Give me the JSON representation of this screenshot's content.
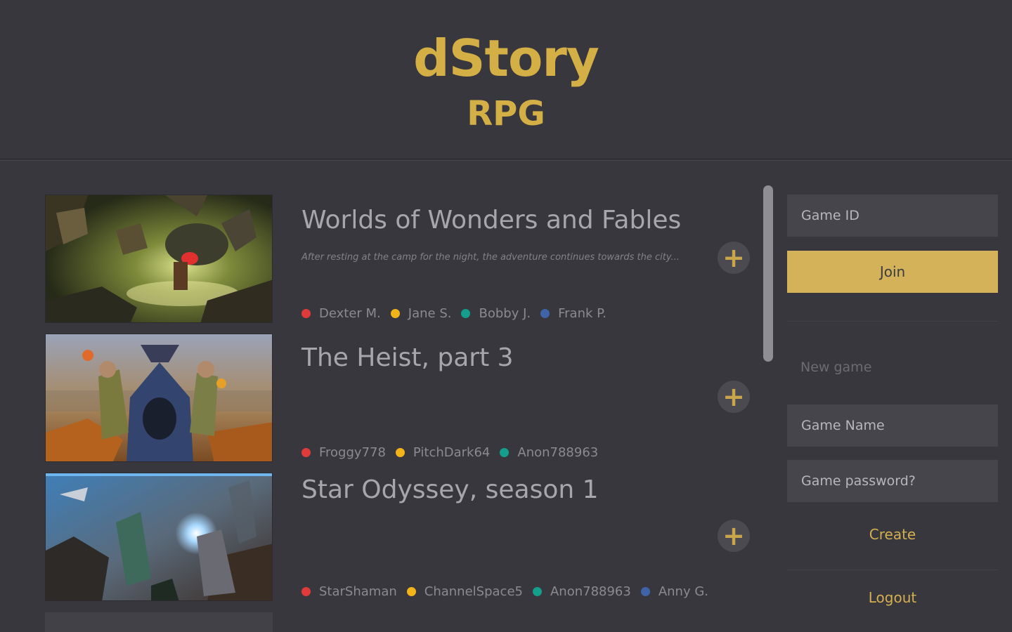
{
  "header": {
    "title": "dStory",
    "subtitle": "RPG"
  },
  "games": [
    {
      "title": "Worlds of Wonders and Fables",
      "description": "After resting at the camp for the night, the adventure continues towards the city...",
      "image": "fantasy-cave-artwork",
      "players": [
        {
          "name": "Dexter M.",
          "color": "#e03a3a"
        },
        {
          "name": "Jane S.",
          "color": "#f2b418"
        },
        {
          "name": "Bobby J.",
          "color": "#149e8c"
        },
        {
          "name": "Frank P.",
          "color": "#3f63a8"
        }
      ]
    },
    {
      "title": "The Heist, part 3",
      "description": "",
      "image": "hooded-figure-artwork",
      "players": [
        {
          "name": "Froggy778",
          "color": "#e03a3a"
        },
        {
          "name": "PitchDark64",
          "color": "#f2b418"
        },
        {
          "name": "Anon788963",
          "color": "#149e8c"
        }
      ]
    },
    {
      "title": "Star Odyssey, season 1",
      "description": "",
      "image": "sci-fi-battle-artwork",
      "players": [
        {
          "name": "StarShaman",
          "color": "#e03a3a"
        },
        {
          "name": "ChannelSpace5",
          "color": "#f2b418"
        },
        {
          "name": "Anon788963",
          "color": "#149e8c"
        },
        {
          "name": "Anny G.",
          "color": "#3f63a8"
        }
      ]
    }
  ],
  "add_icon": "plus-icon",
  "sidebar": {
    "game_id_placeholder": "Game ID",
    "join_label": "Join",
    "new_game_label": "New game",
    "game_name_placeholder": "Game Name",
    "game_password_placeholder": "Game password?",
    "create_label": "Create",
    "logout_label": "Logout"
  },
  "colors": {
    "accent": "#d4af46",
    "background": "#37373d",
    "field": "#45454b"
  }
}
